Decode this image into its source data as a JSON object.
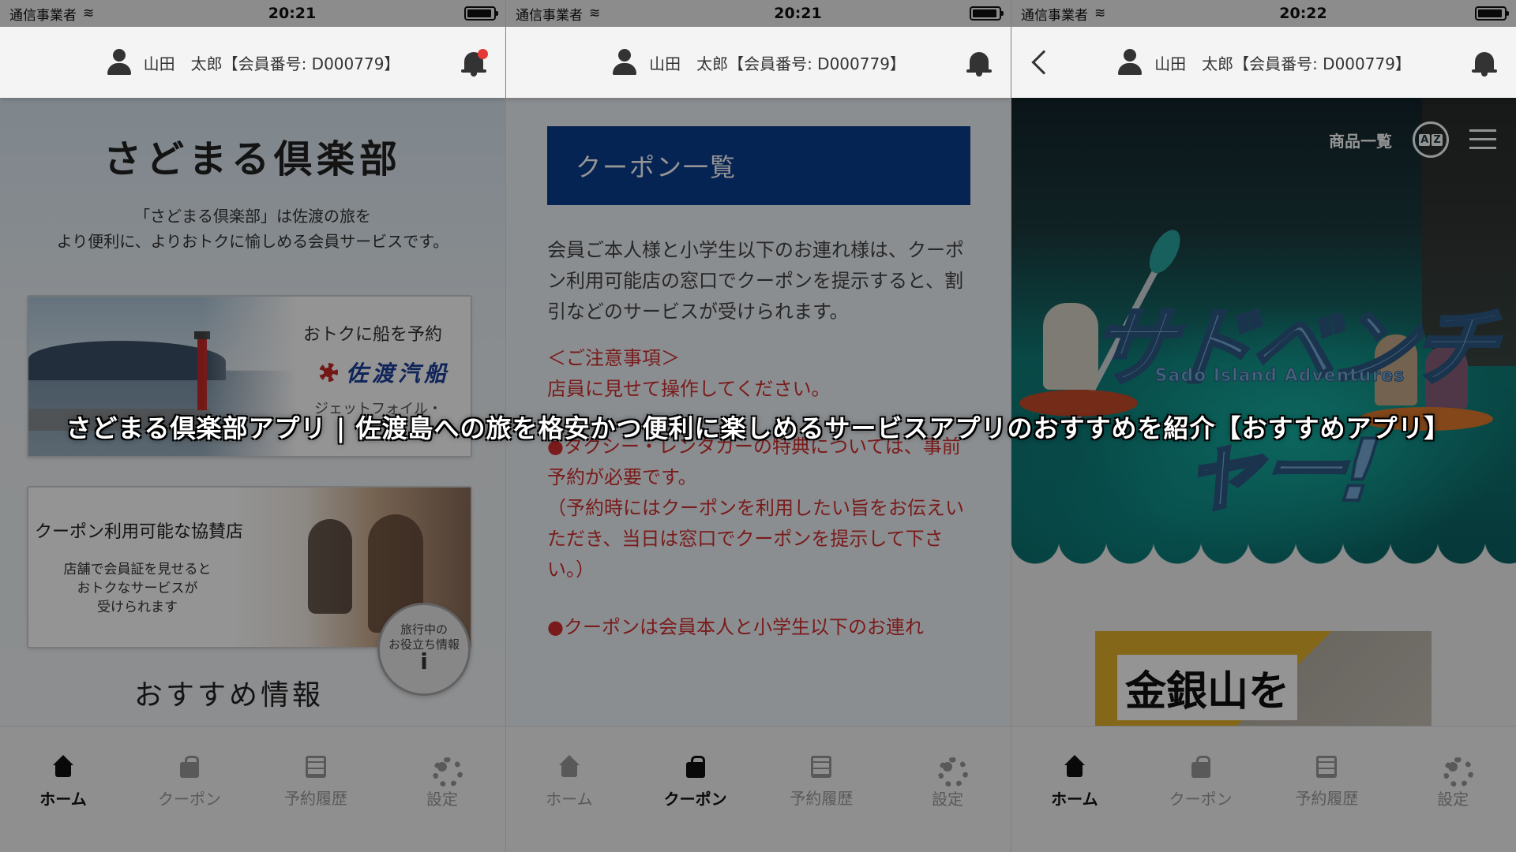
{
  "status_bar": {
    "carrier": "通信事業者",
    "times": [
      "20:21",
      "20:21",
      "20:22"
    ]
  },
  "header": {
    "user_label": "山田　太郎【会員番号: D000779】"
  },
  "tabs": [
    "ホーム",
    "クーポン",
    "予約履歴",
    "設定"
  ],
  "home": {
    "title": "さどまる倶楽部",
    "description": "「さどまる倶楽部」は佐渡の旅を\nより便利に、よりおトクに愉しめる会員サービスです。",
    "ferry_card": {
      "label": "おトクに船を予約",
      "brand": "佐渡汽船",
      "sub": "ジェットフォイル・"
    },
    "coupon_card": {
      "title": "クーポン利用可能な協賛店",
      "desc": "店舗で会員証を見せると\nおトクなサービスが\n受けられます"
    },
    "info_badge": {
      "text": "旅行中の\nお役立ち情報",
      "icon_letter": "i"
    },
    "recommend_title": "おすすめ情報"
  },
  "coupon": {
    "title": "クーポン一覧",
    "intro": "会員ご本人様と小学生以下のお連れ様は、クーポン利用可能店の窓口でクーポンを提示すると、割引などのサービスが受けられます。",
    "notice_title": "＜ご注意事項＞",
    "notice_1": "店員に見せて操作してください。",
    "notice_2a": "●タクシー・レンタカーの特典については、事前予約が必要です。",
    "notice_2b": "（予約時にはクーポンを利用したい旨をお伝えいただき、当日は窓口でクーポンを提示して下さい。）",
    "notice_3": "●クーポンは会員本人と小学生以下のお連れ"
  },
  "web": {
    "product_list": "商品一覧",
    "lang_a": "A",
    "lang_z": "Z",
    "logo": "サドベンチャー!",
    "logo_sub": "Sado Island Adventures",
    "promo_text": "金銀山を"
  },
  "caption": "さどまる倶楽部アプリ | 佐渡島への旅を格安かつ便利に楽しめるサービスアプリのおすすめを紹介【おすすめアプリ】",
  "colors": {
    "coupon_header": "#0a3d8f",
    "notice_red": "#d32f2f",
    "notification_dot": "#e53935"
  }
}
